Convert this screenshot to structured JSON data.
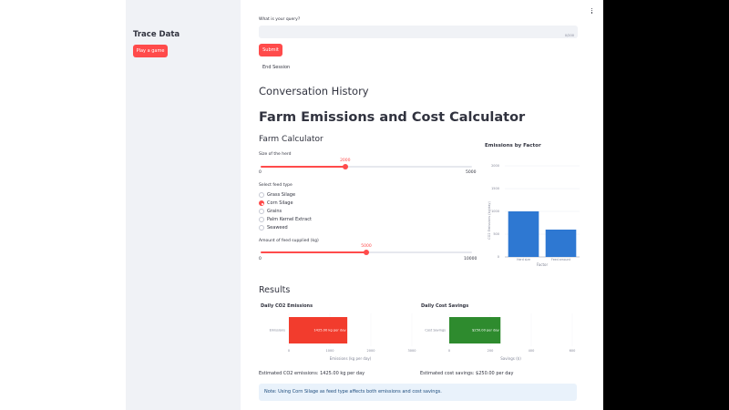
{
  "sidebar": {
    "title": "Trace Data",
    "play_button": "Play a game"
  },
  "query": {
    "label": "What is your query?",
    "counter": "0/200",
    "value": ""
  },
  "buttons": {
    "submit": "Submit",
    "end_session": "End Session"
  },
  "headings": {
    "conversation": "Conversation History",
    "title": "Farm Emissions and Cost Calculator",
    "calculator": "Farm Calculator",
    "results": "Results"
  },
  "herd_slider": {
    "label": "Size of the herd",
    "value": "2000",
    "min": "0",
    "max": "5000",
    "fraction": 0.4
  },
  "feed_type": {
    "label": "Select feed type",
    "options": [
      "Grass Silage",
      "Corn Silage",
      "Grains",
      "Palm Kernel Extract",
      "Seaweed"
    ],
    "selected": "Corn Silage"
  },
  "feed_slider": {
    "label": "Amount of feed supplied (kg)",
    "value": "5000",
    "min": "0",
    "max": "10000",
    "fraction": 0.5
  },
  "colors": {
    "accent": "#ff4b4b",
    "bar_blue": "#2e78d2",
    "bar_red": "#f23c2d",
    "bar_green": "#2e8b2e"
  },
  "chart_data": [
    {
      "type": "bar",
      "title": "Emissions by Factor",
      "xlabel": "Factor",
      "ylabel": "CO2 Emissions (kg/day)",
      "categories": [
        "Herd size",
        "Feed amount"
      ],
      "values": [
        1000,
        600
      ],
      "yticks": [
        "2000",
        "1500",
        "1000",
        "500",
        "0"
      ],
      "ylim": [
        0,
        2000
      ]
    },
    {
      "type": "bar",
      "orientation": "horizontal",
      "title": "Daily CO2 Emissions",
      "categories": [
        "Emissions"
      ],
      "values": [
        1425
      ],
      "data_label": "1425.00 kg per day",
      "xlabel": "Emissions (kg per day)",
      "xticks": [
        "0",
        "1000",
        "2000",
        "3000"
      ],
      "xlim": [
        0,
        3000
      ]
    },
    {
      "type": "bar",
      "orientation": "horizontal",
      "title": "Daily Cost Savings",
      "categories": [
        "Cost Savings"
      ],
      "values": [
        250
      ],
      "data_label": "$250.00 per day",
      "xlabel": "Savings ($)",
      "xticks": [
        "0",
        "200",
        "400",
        "600"
      ],
      "xlim": [
        0,
        600
      ]
    }
  ],
  "estimates": {
    "emissions": "Estimated CO2 emissions: 1425.00 kg per day",
    "savings": "Estimated cost savings: $250.00 per day"
  },
  "note": "Note: Using Corn Silage as feed type affects both emissions and cost savings."
}
